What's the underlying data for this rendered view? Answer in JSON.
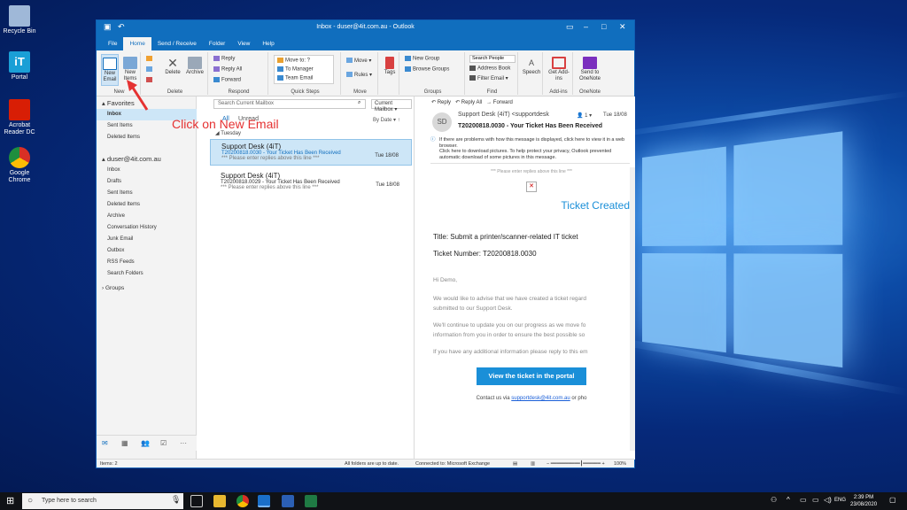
{
  "desktop": {
    "icons": [
      {
        "label": "Recycle Bin",
        "color": "#9fb8d8"
      },
      {
        "label": "Portal",
        "color": "#1a9fd6"
      },
      {
        "label": "Acrobat Reader DC",
        "color": "#d81e05"
      },
      {
        "label": "Google Chrome",
        "color": "#e8b425"
      }
    ]
  },
  "window": {
    "title": "Inbox - duser@4it.com.au - Outlook",
    "menu": [
      "File",
      "Home",
      "Send / Receive",
      "Folder",
      "View",
      "Help"
    ],
    "active_menu": "Home"
  },
  "ribbon": {
    "new_email": "New Email",
    "new_items": "New Items",
    "new_group": "New",
    "delete": "Delete",
    "archive": "Archive",
    "delete_group": "Delete",
    "reply": "Reply",
    "reply_all": "Reply All",
    "forward": "Forward",
    "respond_group": "Respond",
    "qs_move_to": "Move to: ?",
    "qs_to_manager": "To Manager",
    "qs_team_email": "Team Email",
    "quick_steps_group": "Quick Steps",
    "move": "Move",
    "rules": "Rules",
    "move_group": "Move",
    "tags": "Tags",
    "new_group_btn": "New Group",
    "browse_groups": "Browse Groups",
    "groups_group": "Groups",
    "search_people": "Search People",
    "address_book": "Address Book",
    "filter_email": "Filter Email",
    "find_group": "Find",
    "speech": "Speech",
    "get_addins": "Get Add-ins",
    "addins_group": "Add-ins",
    "send_onenote": "Send to OneNote",
    "onenote_group": "OneNote"
  },
  "folders": {
    "favorites": "Favorites",
    "fav_items": [
      "Inbox",
      "Sent Items",
      "Deleted Items"
    ],
    "account": "duser@4it.com.au",
    "account_items": [
      "Inbox",
      "Drafts",
      "Sent Items",
      "Deleted Items",
      "Archive",
      "Conversation History",
      "Junk Email",
      "Outbox",
      "RSS Feeds",
      "Search Folders"
    ],
    "groups": "Groups"
  },
  "list": {
    "search_placeholder": "Search Current Mailbox",
    "scope": "Current Mailbox",
    "filter_all": "All",
    "filter_unread": "Unread",
    "sort": "By Date",
    "section": "Tuesday",
    "items": [
      {
        "from": "Support Desk (4iT)",
        "subject": "T20200818.0030 - Your Ticket Has Been Received",
        "date": "Tue 18/08",
        "preview": "*** Please enter replies above this line ***"
      },
      {
        "from": "Support Desk (4iT)",
        "subject": "T20200818.0029 - Your Ticket Has Been Received",
        "date": "Tue 18/08",
        "preview": "*** Please enter replies above this line ***"
      }
    ]
  },
  "reading": {
    "reply": "Reply",
    "reply_all": "Reply All",
    "forward": "Forward",
    "avatar": "SD",
    "from": "Support Desk (4iT) <supportdesk",
    "count": "1",
    "date": "Tue 18/08",
    "subject": "T20200818.0030 - Your Ticket Has Been Received",
    "info1": "If there are problems with how this message is displayed, click here to view it in a web browser.",
    "info2": "Click here to download pictures. To help protect your privacy, Outlook prevented automatic download of some pictures in this message.",
    "reply_line": "*** Please enter replies above this line ***",
    "ticket_created": "Ticket Created",
    "title_line": "Title: Submit a printer/scanner-related IT ticket",
    "ticket_number": "Ticket Number: T20200818.0030",
    "greeting": "Hi  Demo,",
    "para1a": "We would like to advise that we have created a ticket regard",
    "para1b": "submitted to our Support Desk.",
    "para2a": "We'll continue to update you on our progress as we move fo",
    "para2b": "information from you in order to ensure the best possible so",
    "para3": "If you have any additional information please reply to this em",
    "button": "View the ticket in the portal",
    "contact_prefix": "Contact us via",
    "contact_link": "supportdesk@4it.com.au",
    "contact_suffix": "or pho"
  },
  "status": {
    "items": "Items: 2",
    "uptodate": "All folders are up to date.",
    "connected": "Connected to: Microsoft Exchange",
    "zoom": "100%"
  },
  "annotation": "Click on New Email",
  "taskbar": {
    "search": "Type here to search",
    "lang": "ENG",
    "time": "2:39 PM",
    "date": "23/08/2020"
  },
  "colors": {
    "accent": "#106ebe",
    "annotation": "#e53232",
    "selection": "#cde6f7"
  }
}
